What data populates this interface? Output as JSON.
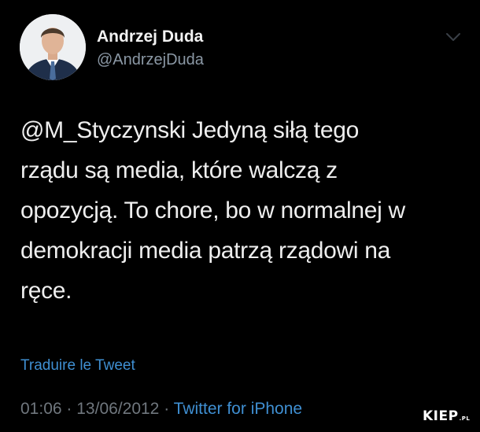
{
  "author": {
    "display_name": "Andrzej Duda",
    "handle": "@AndrzejDuda"
  },
  "tweet": {
    "lines": [
      "@M_Styczynski Jedyną siłą tego",
      "rządu są media, które walczą z",
      "opozycją. To chore, bo w normalnej w",
      "demokracji media patrzą rządowi na",
      "ręce."
    ],
    "translate_label": "Traduire le Tweet",
    "time": "01:06",
    "separator_1": "·",
    "date": "13/06/2012",
    "separator_2": "·",
    "source": "Twitter for iPhone"
  },
  "watermark": {
    "text": "KIEP",
    "suffix": ".PL"
  },
  "colors": {
    "background": "#000000",
    "text": "#eeeeee",
    "secondary": "#70777e",
    "link": "#3f8fd2"
  },
  "icons": {
    "avatar": "avatar-photo",
    "menu": "chevron-down-icon"
  }
}
